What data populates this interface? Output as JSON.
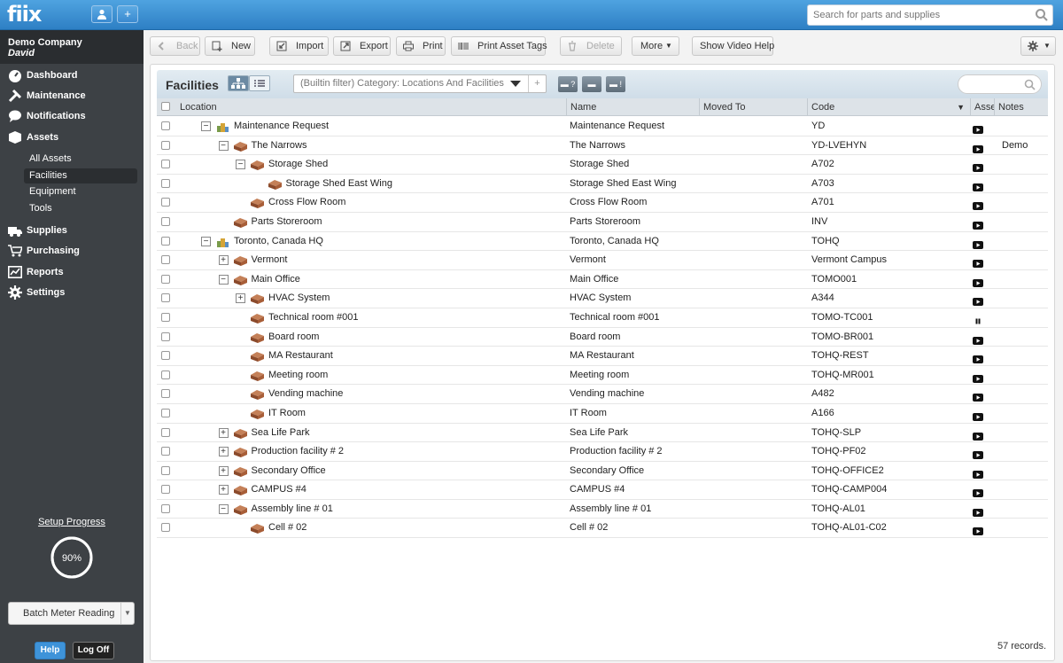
{
  "app": {
    "logo": "fiix",
    "search_placeholder": "Search for parts and supplies"
  },
  "sidebar": {
    "company": "Demo Company",
    "user": "David",
    "nav": [
      {
        "label": "Dashboard",
        "icon": "dashboard-icon"
      },
      {
        "label": "Maintenance",
        "icon": "tools-icon"
      },
      {
        "label": "Notifications",
        "icon": "chat-icon"
      },
      {
        "label": "Assets",
        "icon": "box-icon"
      }
    ],
    "asset_subs": [
      "All Assets",
      "Facilities",
      "Equipment",
      "Tools"
    ],
    "nav2": [
      {
        "label": "Supplies",
        "icon": "truck-icon"
      },
      {
        "label": "Purchasing",
        "icon": "cart-icon"
      },
      {
        "label": "Reports",
        "icon": "chart-icon"
      },
      {
        "label": "Settings",
        "icon": "gear-icon"
      }
    ],
    "setup_progress_label": "Setup Progress",
    "setup_progress_value": "90%",
    "setup_progress_fraction": 0.9,
    "batch_label": "Batch Meter Reading",
    "help_label": "Help",
    "logoff_label": "Log Off"
  },
  "toolbar": {
    "back": "Back",
    "new": "New",
    "import": "Import",
    "export": "Export",
    "print": "Print",
    "print_tags": "Print Asset Tags",
    "delete": "Delete",
    "more": "More",
    "video_help": "Show Video Help"
  },
  "panel": {
    "title": "Facilities",
    "filter": "(Builtin filter) Category: Locations And Facilities",
    "filter_buttons": [
      "?",
      "",
      "!"
    ],
    "columns": {
      "location": "Location",
      "name": "Name",
      "moved_to": "Moved To",
      "code": "Code",
      "asset": "Asset",
      "notes": "Notes"
    },
    "rows": [
      {
        "loc": "Maintenance Request",
        "name": "Maintenance Request",
        "code": "YD",
        "depth": 0,
        "toggle": "−",
        "icon": "site",
        "asset": "play",
        "note": ""
      },
      {
        "loc": "The Narrows",
        "name": "The Narrows",
        "code": "YD-LVEHYN",
        "depth": 1,
        "toggle": "−",
        "icon": "building",
        "asset": "play",
        "note": "Demo"
      },
      {
        "loc": "Storage Shed",
        "name": "Storage Shed",
        "code": "A702",
        "depth": 2,
        "toggle": "−",
        "icon": "building",
        "asset": "play",
        "note": ""
      },
      {
        "loc": "Storage Shed East Wing",
        "name": "Storage Shed East Wing",
        "code": "A703",
        "depth": 3,
        "toggle": "",
        "icon": "building",
        "asset": "play",
        "note": ""
      },
      {
        "loc": "Cross Flow Room",
        "name": "Cross Flow Room",
        "code": "A701",
        "depth": 2,
        "toggle": "",
        "icon": "building",
        "asset": "play",
        "note": ""
      },
      {
        "loc": "Parts Storeroom",
        "name": "Parts Storeroom",
        "code": "INV",
        "depth": 1,
        "toggle": "",
        "icon": "building",
        "asset": "play",
        "note": ""
      },
      {
        "loc": "Toronto, Canada HQ",
        "name": "Toronto, Canada HQ",
        "code": "TOHQ",
        "depth": 0,
        "toggle": "−",
        "icon": "site",
        "asset": "play",
        "note": ""
      },
      {
        "loc": "Vermont",
        "name": "Vermont",
        "code": "Vermont Campus",
        "depth": 1,
        "toggle": "+",
        "icon": "building",
        "asset": "play",
        "note": ""
      },
      {
        "loc": "Main Office",
        "name": "Main Office",
        "code": "TOMO001",
        "depth": 1,
        "toggle": "−",
        "icon": "building",
        "asset": "play",
        "note": ""
      },
      {
        "loc": "HVAC System",
        "name": "HVAC System",
        "code": "A344",
        "depth": 2,
        "toggle": "+",
        "icon": "building",
        "asset": "play",
        "note": ""
      },
      {
        "loc": "Technical room #001",
        "name": "Technical room #001",
        "code": "TOMO-TC001",
        "depth": 2,
        "toggle": "",
        "icon": "building",
        "asset": "pause",
        "note": ""
      },
      {
        "loc": "Board room",
        "name": "Board room",
        "code": "TOMO-BR001",
        "depth": 2,
        "toggle": "",
        "icon": "building",
        "asset": "play",
        "note": ""
      },
      {
        "loc": "MA Restaurant",
        "name": "MA Restaurant",
        "code": "TOHQ-REST",
        "depth": 2,
        "toggle": "",
        "icon": "building",
        "asset": "play",
        "note": ""
      },
      {
        "loc": "Meeting room",
        "name": "Meeting room",
        "code": "TOHQ-MR001",
        "depth": 2,
        "toggle": "",
        "icon": "building",
        "asset": "play",
        "note": ""
      },
      {
        "loc": "Vending machine",
        "name": "Vending machine",
        "code": "A482",
        "depth": 2,
        "toggle": "",
        "icon": "building",
        "asset": "play",
        "note": ""
      },
      {
        "loc": "IT Room",
        "name": "IT Room",
        "code": "A166",
        "depth": 2,
        "toggle": "",
        "icon": "building",
        "asset": "play",
        "note": ""
      },
      {
        "loc": "Sea Life Park",
        "name": "Sea Life Park",
        "code": "TOHQ-SLP",
        "depth": 1,
        "toggle": "+",
        "icon": "building",
        "asset": "play",
        "note": ""
      },
      {
        "loc": "Production facility # 2",
        "name": "Production facility # 2",
        "code": "TOHQ-PF02",
        "depth": 1,
        "toggle": "+",
        "icon": "building",
        "asset": "play",
        "note": ""
      },
      {
        "loc": "Secondary Office",
        "name": "Secondary Office",
        "code": "TOHQ-OFFICE2",
        "depth": 1,
        "toggle": "+",
        "icon": "building",
        "asset": "play",
        "note": ""
      },
      {
        "loc": "CAMPUS #4",
        "name": "CAMPUS #4",
        "code": "TOHQ-CAMP004",
        "depth": 1,
        "toggle": "+",
        "icon": "building",
        "asset": "play",
        "note": ""
      },
      {
        "loc": "Assembly line # 01",
        "name": "Assembly line # 01",
        "code": "TOHQ-AL01",
        "depth": 1,
        "toggle": "−",
        "icon": "building",
        "asset": "play",
        "note": ""
      },
      {
        "loc": "Cell # 02",
        "name": "Cell # 02",
        "code": "TOHQ-AL01-C02",
        "depth": 2,
        "toggle": "",
        "icon": "building",
        "asset": "play",
        "note": ""
      }
    ],
    "records": "57 records."
  }
}
